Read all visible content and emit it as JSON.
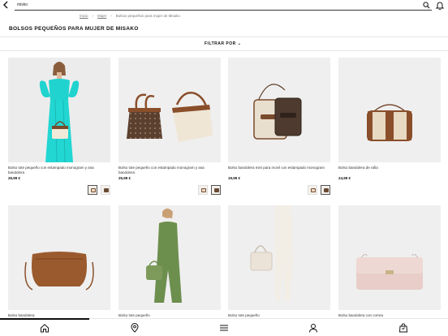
{
  "search": {
    "query": "misko"
  },
  "breadcrumb": {
    "items": [
      "Inicio",
      "Mujer",
      "Bolsos pequeños para mujer de Misako"
    ]
  },
  "page": {
    "title": "BOLSOS PEQUEÑOS PARA MUJER DE MISAKO"
  },
  "filter": {
    "label": "FILTRAR POR"
  },
  "products": [
    {
      "name": "Bolso tote pequeño con estampado monogram y asa bandolera",
      "price": "25,99 €",
      "swatches": [
        "#e9ddc8",
        "#6b4a33"
      ]
    },
    {
      "name": "Bolso tote pequeño con estampado monogram y asa bandolera",
      "price": "25,99 €",
      "swatches": [
        "#e9ddc8",
        "#6b4a33"
      ]
    },
    {
      "name": "Bolso bandolera mini para movil con estampado monogram",
      "price": "19,99 €",
      "swatches": [
        "#e9ddc8",
        "#6b4a33"
      ]
    },
    {
      "name": "Bolso bandolera de rafia",
      "price": "24,99 €",
      "swatches": []
    },
    {
      "name": "Bolso bandolera",
      "price": "",
      "swatches": []
    },
    {
      "name": "Bolso tote pequeño",
      "price": "",
      "swatches": []
    },
    {
      "name": "Bolso tote pequeño",
      "price": "",
      "swatches": []
    },
    {
      "name": "Bolso bandolera con correa",
      "price": "",
      "swatches": []
    }
  ],
  "icons": {
    "back": "chevron-left-icon",
    "search": "search-icon",
    "notifications": "bell-icon",
    "home": "home-icon",
    "stores": "location-pin-icon",
    "menu": "hamburger-menu-icon",
    "account": "user-icon",
    "bag": "shopping-bag-icon"
  },
  "colors": {
    "accent": "#111111",
    "photo_bg": "#efefef",
    "turquoise": "#20d3cf"
  }
}
